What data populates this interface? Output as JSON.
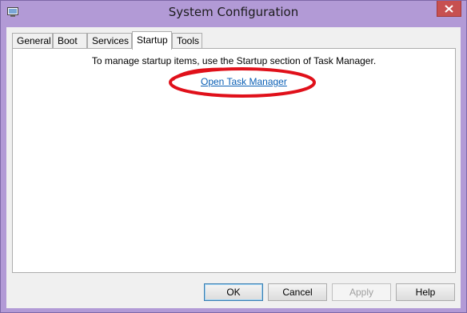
{
  "window": {
    "title": "System Configuration",
    "icon": "msconfig-app-icon",
    "close_icon": "close-icon"
  },
  "tabs": [
    {
      "label": "General",
      "active": false
    },
    {
      "label": "Boot",
      "active": false
    },
    {
      "label": "Services",
      "active": false
    },
    {
      "label": "Startup",
      "active": true
    },
    {
      "label": "Tools",
      "active": false
    }
  ],
  "startup": {
    "message": "To manage startup items, use the Startup section of Task Manager.",
    "link": "Open Task Manager",
    "highlight_color": "#e0101a"
  },
  "buttons": {
    "ok": "OK",
    "cancel": "Cancel",
    "apply": "Apply",
    "help": "Help"
  }
}
